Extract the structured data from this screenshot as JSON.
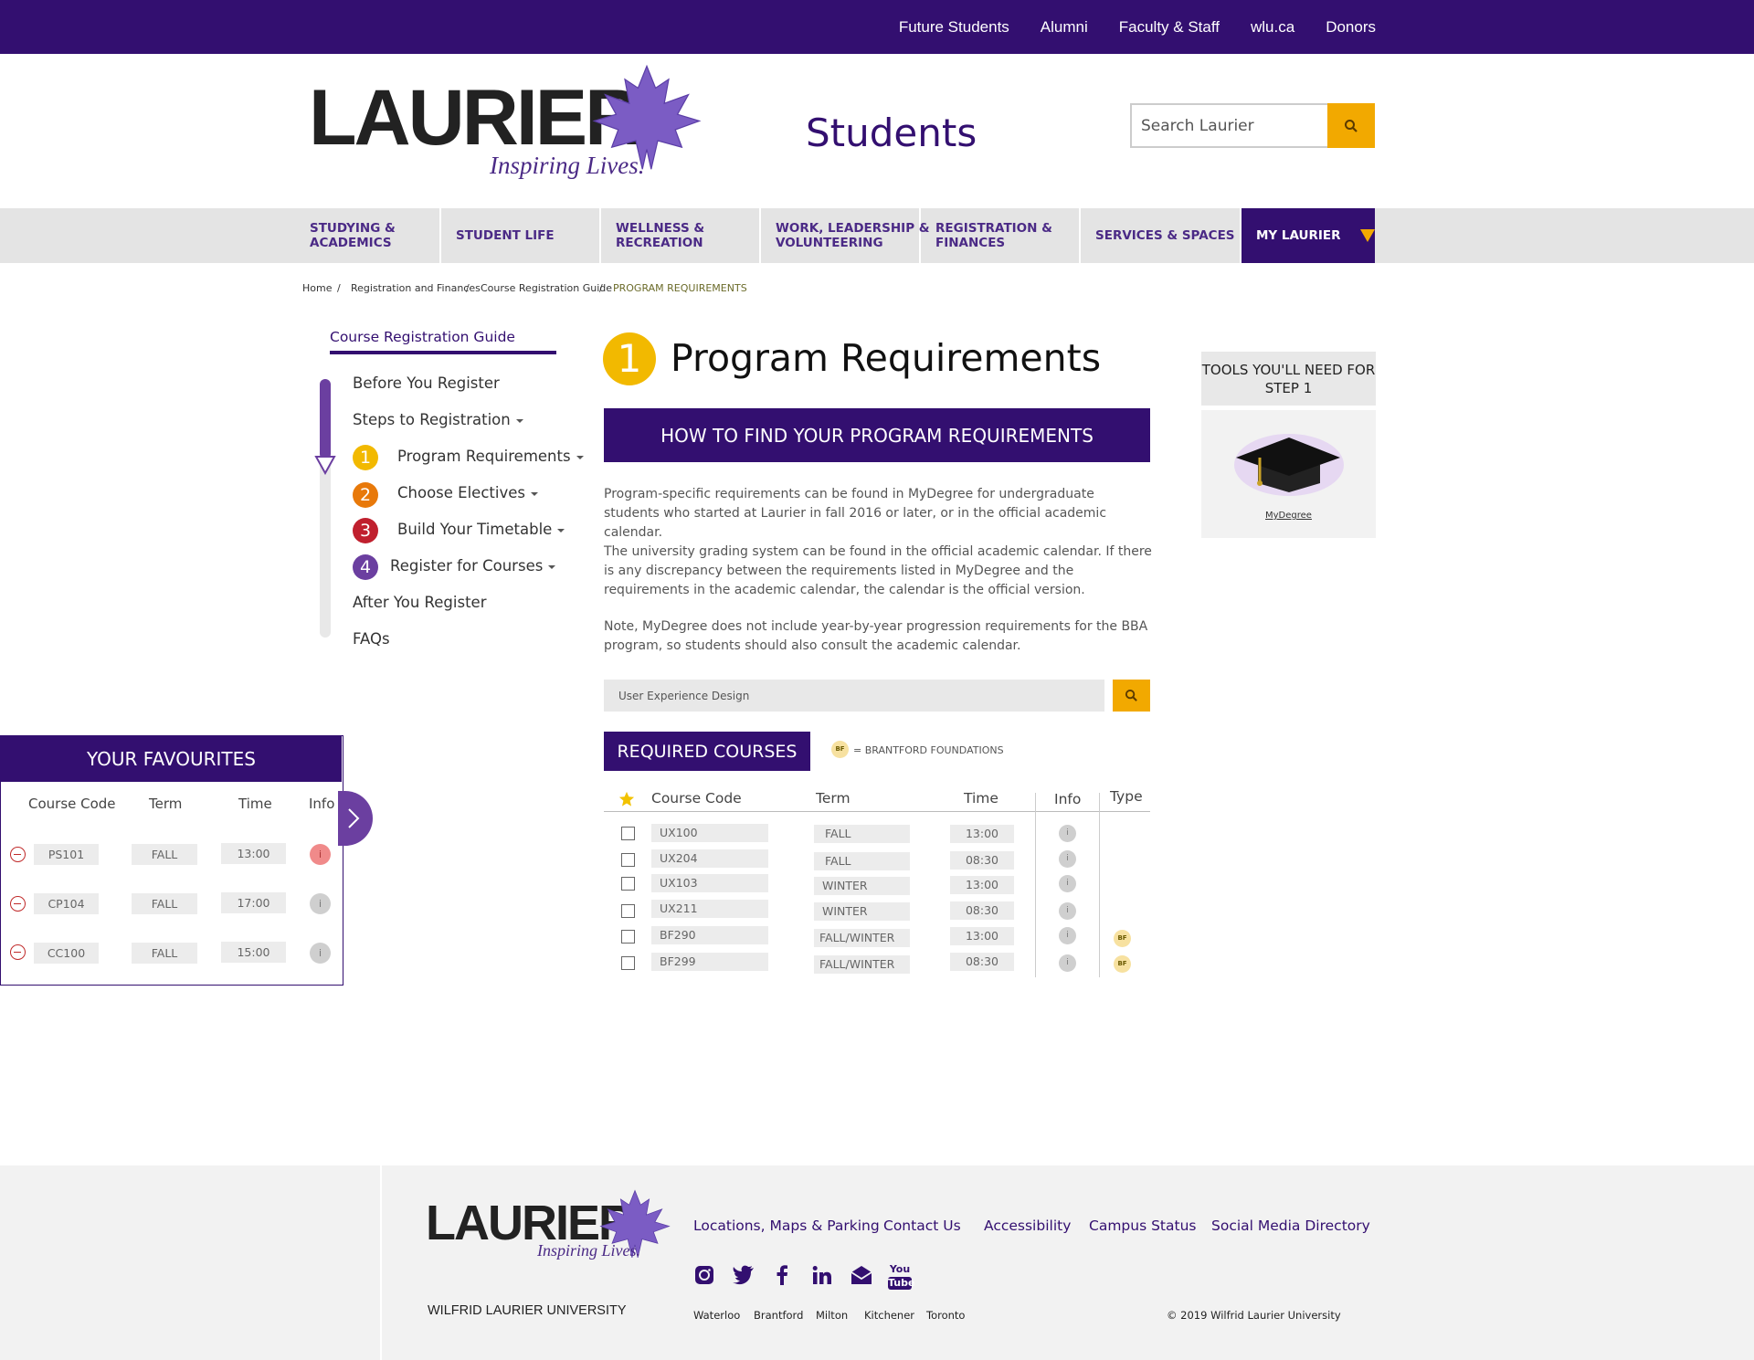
{
  "topnav": [
    "Future Students",
    "Alumni",
    "Faculty & Staff",
    "wlu.ca",
    "Donors"
  ],
  "header": {
    "logo_word": "LAURIER",
    "logo_tagline": "Inspiring Lives.",
    "site_title": "Students",
    "search_placeholder": "Search Laurier"
  },
  "mainnav": [
    {
      "label": "STUDYING &\nACADEMICS"
    },
    {
      "label": "STUDENT LIFE"
    },
    {
      "label": "WELLNESS &\nRECREATION"
    },
    {
      "label": "WORK, LEADERSHIP &\nVOLUNTEERING"
    },
    {
      "label": "REGISTRATION &\nFINANCES"
    },
    {
      "label": "SERVICES & SPACES"
    },
    {
      "label": "MY LAURIER"
    }
  ],
  "breadcrumb": [
    "Home",
    "Registration and Finances",
    "Course Registration Guide",
    "PROGRAM REQUIREMENTS"
  ],
  "sidenav": {
    "title": "Course Registration Guide",
    "items": [
      "Before You Register",
      "Steps to Registration",
      "Program Requirements",
      "Choose Electives",
      "Build Your Timetable",
      "Register for Courses",
      "After You Register",
      "FAQs"
    ],
    "step_numbers": [
      "1",
      "2",
      "3",
      "4"
    ]
  },
  "main": {
    "step_number": "1",
    "title": "Program Requirements",
    "banner": "HOW TO FIND YOUR PROGRAM REQUIREMENTS",
    "paragraphs": [
      "Program-specific requirements can be found in MyDegree for undergraduate students who started at Laurier in fall 2016 or later, or in the official academic calendar.",
      "The university grading system can be found in the official academic calendar. If there is any discrepancy between the requirements listed in MyDegree and the requirements in the academic calendar, the calendar is the official version.",
      "Note, MyDegree does not include year-by-year progression requirements for the BBA program, so students should also consult the academic calendar."
    ],
    "program_search_value": "User Experience Design",
    "required_label": "REQUIRED COURSES",
    "bf_badge": "BF",
    "bf_legend": "= BRANTFORD FOUNDATIONS",
    "table_headers": [
      "Course Code",
      "Term",
      "Time",
      "Info",
      "Type"
    ],
    "courses": [
      {
        "code": "UX100",
        "term": "FALL",
        "time": "13:00",
        "info": "i",
        "type": ""
      },
      {
        "code": "UX204",
        "term": "FALL",
        "time": "08:30",
        "info": "i",
        "type": ""
      },
      {
        "code": "UX103",
        "term": "WINTER",
        "time": "13:00",
        "info": "i",
        "type": ""
      },
      {
        "code": "UX211",
        "term": "WINTER",
        "time": "08:30",
        "info": "i",
        "type": ""
      },
      {
        "code": "BF290",
        "term": "FALL/WINTER",
        "time": "13:00",
        "info": "i",
        "type": "BF"
      },
      {
        "code": "BF299",
        "term": "FALL/WINTER",
        "time": "08:30",
        "info": "i",
        "type": "BF"
      }
    ]
  },
  "tools": {
    "heading": "TOOLS YOU'LL NEED FOR STEP 1",
    "link": "MyDegree"
  },
  "favourites": {
    "title": "YOUR FAVOURITES",
    "headers": [
      "Course Code",
      "Term",
      "Time",
      "Info"
    ],
    "rows": [
      {
        "code": "PS101",
        "term": "FALL",
        "time": "13:00",
        "info": "i"
      },
      {
        "code": "CP104",
        "term": "FALL",
        "time": "17:00",
        "info": "i"
      },
      {
        "code": "CC100",
        "term": "FALL",
        "time": "15:00",
        "info": "i"
      }
    ]
  },
  "footer": {
    "logo_word": "LAURIER",
    "logo_tagline": "Inspiring Lives.",
    "university": "WILFRID LAURIER UNIVERSITY",
    "links": [
      "Locations, Maps & Parking",
      "Contact Us",
      "Accessibility",
      "Campus Status",
      "Social Media Directory"
    ],
    "social_icons": [
      "instagram-icon",
      "twitter-icon",
      "facebook-icon",
      "linkedin-icon",
      "email-icon",
      "youtube-icon"
    ],
    "youtube_text": [
      "You",
      "Tube"
    ],
    "cities": [
      "Waterloo",
      "Brantford",
      "Milton",
      "Kitchener",
      "Toronto"
    ],
    "copyright": "© 2019 Wilfrid Laurier University"
  },
  "colors": {
    "primary": "#330f70",
    "accent": "#f2a900",
    "step1": "#f2b900",
    "step2": "#e8790a",
    "step3": "#c0202e",
    "step4": "#6b3fa0"
  }
}
